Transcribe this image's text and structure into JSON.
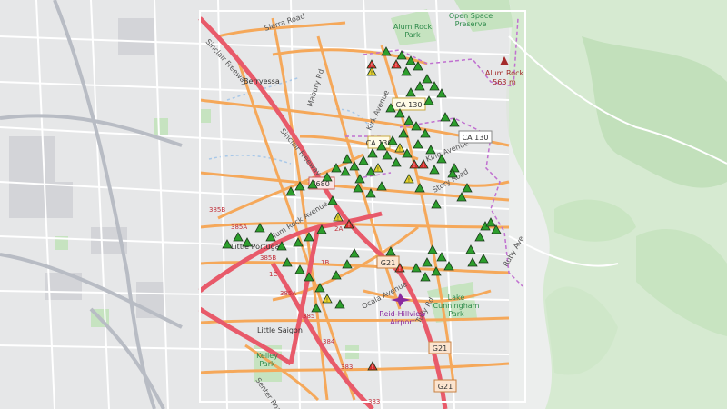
{
  "map": {
    "labels": {
      "sierra_road": "Sierra Road",
      "berryessa": "Berryessa",
      "sinclair_freeway_1": "Sinclair Freeway",
      "sinclair_freeway_2": "Sinclair Freeway",
      "mabury_rd": "Mabury Rd",
      "kirk_avenue": "Kirk Avenue",
      "alum_rock_avenue": "Alum Rock Avenue",
      "alum_rock_park": "Alum Rock\nPark",
      "open_space_preserve": "Open Space\nPreserve",
      "alum_rock_peak": "Alum Rock",
      "peak_elevation": "563 m",
      "king_avenue": "King Avenue",
      "story_road": "Story Road",
      "little_portugal": "Little Portugal",
      "little_saigon": "Little Saigon",
      "ocala_avenue": "Ocala Avenue",
      "lake_cunningham_park": "Lake\nCunningham\nPark",
      "reid_hillview_airport": "Reid-Hillview\nAirport",
      "tully_rd": "Tully Rd",
      "ruby_ave": "Ruby Ave",
      "kelley_park": "Kelley\nPark",
      "senter_road": "Senter Road"
    },
    "shields": {
      "ca130_a": "CA 130",
      "ca130_b": "CA 130",
      "ca130_c": "CA 130",
      "i680": "I680",
      "g21_a": "G21",
      "g21_b": "G21",
      "g21_c": "G21"
    },
    "exits": [
      "385B",
      "385A",
      "385B",
      "385A",
      "385",
      "384",
      "383",
      "383",
      "2A",
      "1B",
      "1C"
    ],
    "colors": {
      "background": "#e9e9ea",
      "water": "#a8c8e8",
      "park": "#c6e3c0",
      "major_road": "#f5a85a",
      "freeway": "#e85a6a",
      "marker_green": "#2c9e2c",
      "marker_yellow": "#e6d22a",
      "marker_red": "#d92d2d",
      "boundary": "#c070d0",
      "airport": "#8a2aa0",
      "study_area": "#ffffff"
    },
    "marker_types": [
      "green-triangle",
      "yellow-triangle",
      "red-triangle"
    ]
  }
}
